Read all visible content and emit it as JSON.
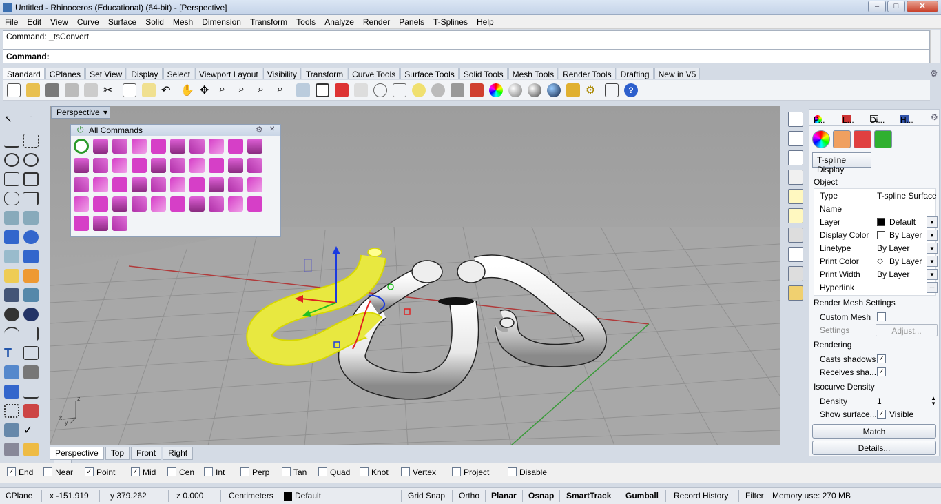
{
  "window": {
    "title": "Untitled - Rhinoceros (Educational) (64-bit) - [Perspective]",
    "min": "–",
    "max": "□",
    "close": "✕"
  },
  "menu": [
    "File",
    "Edit",
    "View",
    "Curve",
    "Surface",
    "Solid",
    "Mesh",
    "Dimension",
    "Transform",
    "Tools",
    "Analyze",
    "Render",
    "Panels",
    "T-Splines",
    "Help"
  ],
  "command": {
    "history": "Command: _tsConvert",
    "prompt": "Command:"
  },
  "toolbar_tabs": [
    "Standard",
    "CPlanes",
    "Set View",
    "Display",
    "Select",
    "Viewport Layout",
    "Visibility",
    "Transform",
    "Curve Tools",
    "Surface Tools",
    "Solid Tools",
    "Mesh Tools",
    "Render Tools",
    "Drafting",
    "New in V5"
  ],
  "viewport": {
    "label": "Perspective",
    "dropdown": "▾",
    "axes": {
      "z": "z",
      "x": "x",
      "y": "y"
    }
  },
  "viewport_tabs": [
    "Perspective",
    "Top",
    "Front",
    "Right",
    "✚"
  ],
  "popup": {
    "title": "All Commands",
    "gear": "⚙",
    "close": "✕",
    "power": "⏻"
  },
  "panel": {
    "tabs": [
      "P...",
      "L...",
      "Di...",
      "H..."
    ],
    "tspline_display": "T-spline Display",
    "object_header": "Object",
    "rows": [
      {
        "k": "Type",
        "v": "T-spline Surface"
      },
      {
        "k": "Name",
        "v": ""
      },
      {
        "k": "Layer",
        "v": "Default"
      },
      {
        "k": "Display Color",
        "v": "By Layer"
      },
      {
        "k": "Linetype",
        "v": "By Layer"
      },
      {
        "k": "Print Color",
        "v": "By Layer"
      },
      {
        "k": "Print Width",
        "v": "By Layer"
      },
      {
        "k": "Hyperlink",
        "v": "..."
      }
    ],
    "render_mesh_header": "Render Mesh Settings",
    "custom_mesh": "Custom Mesh",
    "settings": "Settings",
    "adjust": "Adjust...",
    "rendering_header": "Rendering",
    "casts_shadows": "Casts shadows",
    "receives_shadows": "Receives sha...",
    "isocurve_header": "Isocurve Density",
    "density_label": "Density",
    "density_value": "1",
    "show_surface": "Show surface...",
    "visible": "Visible",
    "match": "Match",
    "details": "Details..."
  },
  "osnaps": [
    {
      "label": "End",
      "checked": true
    },
    {
      "label": "Near",
      "checked": false
    },
    {
      "label": "Point",
      "checked": true
    },
    {
      "label": "Mid",
      "checked": true
    },
    {
      "label": "Cen",
      "checked": false
    },
    {
      "label": "Int",
      "checked": false
    },
    {
      "label": "Perp",
      "checked": false
    },
    {
      "label": "Tan",
      "checked": false
    },
    {
      "label": "Quad",
      "checked": false
    },
    {
      "label": "Knot",
      "checked": false
    },
    {
      "label": "Vertex",
      "checked": false
    },
    {
      "label": "Project",
      "checked": false
    },
    {
      "label": "Disable",
      "checked": false
    }
  ],
  "status": {
    "cplane": "CPlane",
    "x": "x -151.919",
    "y": "y 379.262",
    "z": "z 0.000",
    "units": "Centimeters",
    "layer": "Default",
    "grid_snap": "Grid Snap",
    "ortho": "Ortho",
    "planar": "Planar",
    "osnap": "Osnap",
    "smarttrack": "SmartTrack",
    "gumball": "Gumball",
    "record_history": "Record History",
    "filter": "Filter",
    "memory": "Memory use: 270 MB"
  },
  "colors": {
    "accent": "#3a6fb0",
    "selection": "#f0f000",
    "command_icon": "#d63fc7"
  }
}
